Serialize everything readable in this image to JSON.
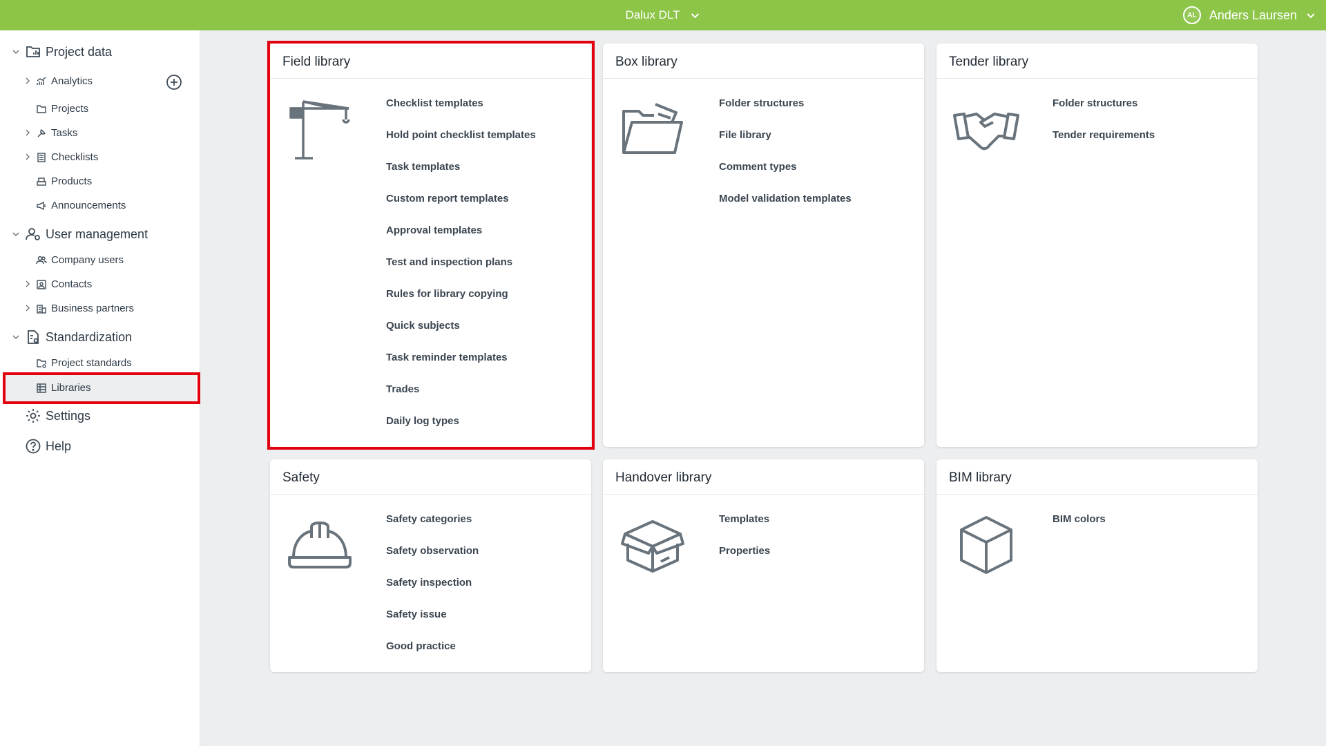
{
  "topbar": {
    "project_name": "Dalux DLT",
    "user_initials": "AL",
    "user_name": "Anders Laursen"
  },
  "sidebar": {
    "project_data": {
      "label": "Project data",
      "items": [
        {
          "label": "Analytics"
        },
        {
          "label": "Projects"
        },
        {
          "label": "Tasks"
        },
        {
          "label": "Checklists"
        },
        {
          "label": "Products"
        },
        {
          "label": "Announcements"
        }
      ]
    },
    "user_management": {
      "label": "User management",
      "items": [
        {
          "label": "Company users"
        },
        {
          "label": "Contacts"
        },
        {
          "label": "Business partners"
        }
      ]
    },
    "standardization": {
      "label": "Standardization",
      "items": [
        {
          "label": "Project standards"
        },
        {
          "label": "Libraries"
        }
      ]
    },
    "settings": {
      "label": "Settings"
    },
    "help": {
      "label": "Help"
    }
  },
  "cards": [
    {
      "title": "Field library",
      "icon": "crane-icon",
      "links": [
        "Checklist templates",
        "Hold point checklist templates",
        "Task templates",
        "Custom report templates",
        "Approval templates",
        "Test and inspection plans",
        "Rules for library copying",
        "Quick subjects",
        "Task reminder templates",
        "Trades",
        "Daily log types"
      ]
    },
    {
      "title": "Box library",
      "icon": "folder-icon",
      "links": [
        "Folder structures",
        "File library",
        "Comment types",
        "Model validation templates"
      ]
    },
    {
      "title": "Tender library",
      "icon": "handshake-icon",
      "links": [
        "Folder structures",
        "Tender requirements"
      ]
    },
    {
      "title": "Safety",
      "icon": "hard-hat-icon",
      "links": [
        "Safety categories",
        "Safety observation",
        "Safety inspection",
        "Safety issue",
        "Good practice"
      ]
    },
    {
      "title": "Handover library",
      "icon": "open-box-icon",
      "links": [
        "Templates",
        "Properties"
      ]
    },
    {
      "title": "BIM library",
      "icon": "cube-icon",
      "links": [
        "BIM colors"
      ]
    }
  ],
  "colors": {
    "topbar": "#8dc548",
    "highlight": "#e3000f",
    "background": "#eceeef"
  }
}
